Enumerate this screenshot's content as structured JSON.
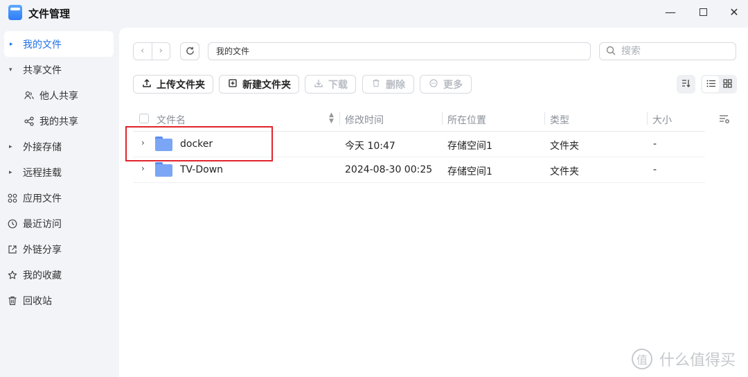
{
  "window": {
    "title": "文件管理",
    "controls": {
      "minimize": "—",
      "close": "✕"
    }
  },
  "sidebar": {
    "items": [
      {
        "label": "我的文件",
        "icon": "caret-right-icon",
        "active": true
      },
      {
        "label": "共享文件",
        "icon": "caret-down-icon"
      },
      {
        "label": "他人共享",
        "icon": "users-icon",
        "sub": true
      },
      {
        "label": "我的共享",
        "icon": "share-icon",
        "sub": true
      },
      {
        "label": "外接存储",
        "icon": "caret-right-icon"
      },
      {
        "label": "远程挂载",
        "icon": "caret-right-icon"
      },
      {
        "label": "应用文件",
        "icon": "apps-icon"
      },
      {
        "label": "最近访问",
        "icon": "clock-icon"
      },
      {
        "label": "外链分享",
        "icon": "link-share-icon"
      },
      {
        "label": "我的收藏",
        "icon": "star-icon"
      },
      {
        "label": "回收站",
        "icon": "trash-icon"
      }
    ]
  },
  "toolbar": {
    "path": "我的文件",
    "search_placeholder": "搜索",
    "upload_label": "上传文件夹",
    "new_folder_label": "新建文件夹",
    "download_label": "下载",
    "delete_label": "删除",
    "more_label": "更多"
  },
  "table": {
    "columns": [
      "文件名",
      "修改时间",
      "所在位置",
      "类型",
      "大小"
    ],
    "rows": [
      {
        "name": "docker",
        "modified": "今天 10:47",
        "location": "存储空间1",
        "type": "文件夹",
        "size": "-"
      },
      {
        "name": "TV-Down",
        "modified": "2024-08-30 00:25",
        "location": "存储空间1",
        "type": "文件夹",
        "size": "-"
      }
    ]
  },
  "watermark": {
    "text": "什么值得买",
    "logo_char": "值"
  },
  "colors": {
    "accent": "#1f6fe5",
    "highlight": "#e0242a",
    "folder": "#7aa6f5"
  }
}
